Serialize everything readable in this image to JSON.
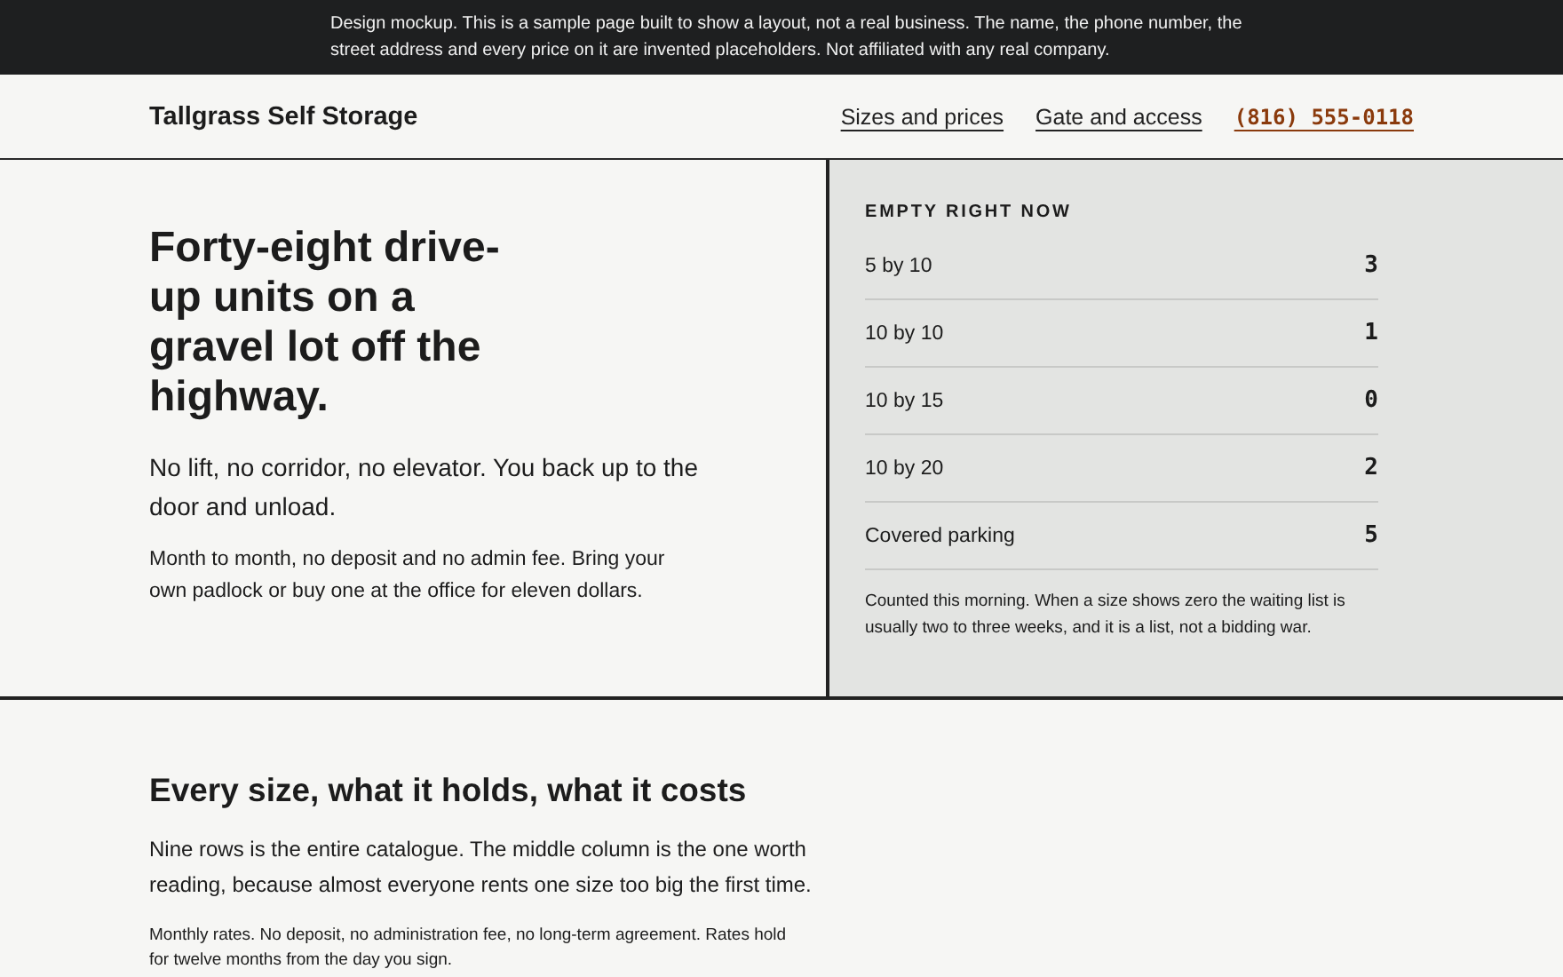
{
  "notice": "Design mockup. This is a sample page built to show a layout, not a real business. The name, the phone number, the street address and every price on it are invented placeholders. Not affiliated with any real company.",
  "header": {
    "brand": "Tallgrass Self Storage",
    "links": [
      {
        "label": "Sizes and prices",
        "kind": "nav"
      },
      {
        "label": "Gate and access",
        "kind": "nav"
      },
      {
        "label": "(816) 555-0118",
        "kind": "phone"
      }
    ]
  },
  "hero": {
    "heading": "Forty-eight drive-up units on a gravel lot off the highway.",
    "lead": "No lift, no corridor, no elevator. You back up to the door and unload.",
    "body": "Month to month, no deposit and no admin fee. Bring your own padlock or buy one at the office for eleven dollars."
  },
  "availability": {
    "title": "EMPTY RIGHT NOW",
    "rows": [
      {
        "size": "5 by 10",
        "count": "3"
      },
      {
        "size": "10 by 10",
        "count": "1"
      },
      {
        "size": "10 by 15",
        "count": "0"
      },
      {
        "size": "10 by 20",
        "count": "2"
      },
      {
        "size": "Covered parking",
        "count": "5"
      }
    ],
    "note": "Counted this morning. When a size shows zero the waiting list is usually two to three weeks, and it is a list, not a bidding war."
  },
  "sizes": {
    "heading": "Every size, what it holds, what it costs",
    "intro": "Nine rows is the entire catalogue. The middle column is the one worth reading, because almost everyone rents one size too big the first time.",
    "note": "Monthly rates. No deposit, no administration fee, no long-term agreement. Rates hold for twelve months from the day you sign."
  }
}
